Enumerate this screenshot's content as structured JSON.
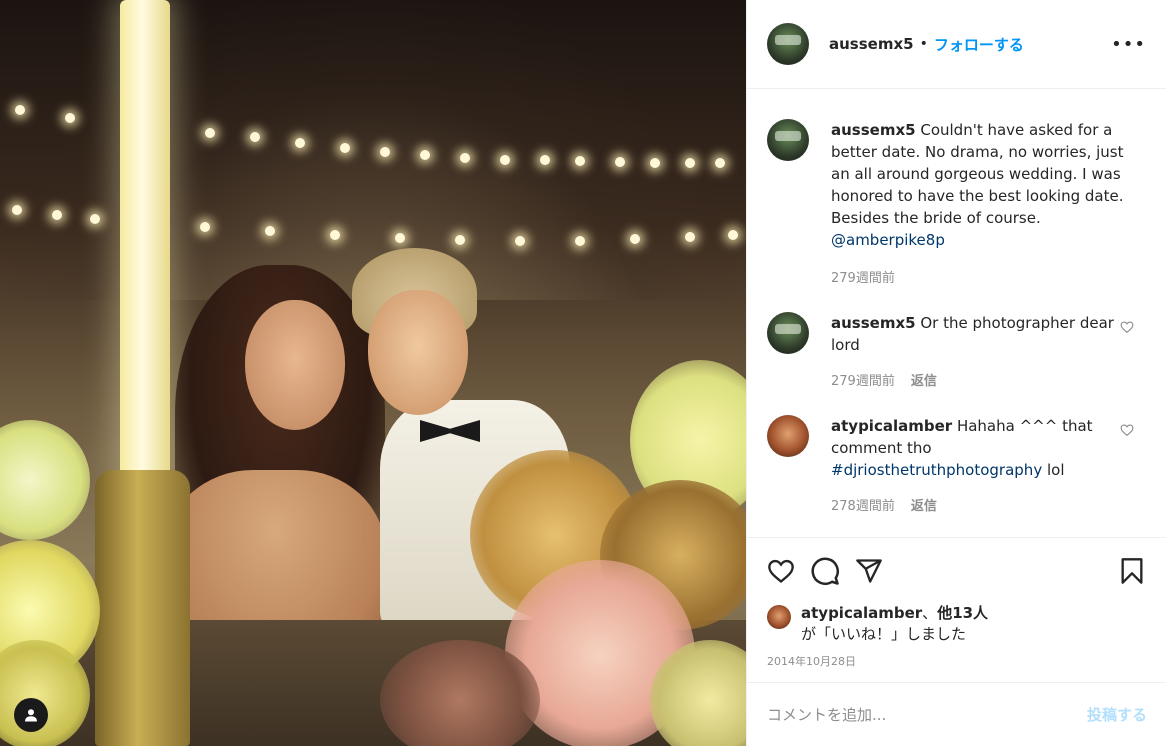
{
  "post": {
    "author": "aussemx5",
    "follow_label": "フォローする",
    "separator": "•",
    "more_label": "•••"
  },
  "comments": [
    {
      "user": "aussemx5",
      "text": "Couldn't have asked for a better date. No drama, no worries, just an all around gorgeous wedding. I was honored to have the best looking date. Besides the bride of course.",
      "mention": "@amberpike8p",
      "time": "279週間前"
    },
    {
      "user": "aussemx5",
      "text": "Or the photographer dear lord",
      "time": "279週間前",
      "reply": "返信"
    },
    {
      "user": "atypicalamber",
      "text": "Hahaha ^^^ that comment tho",
      "hashtag": "#djriosthetruthphotography",
      "suffix": "lol",
      "time": "278週間前",
      "reply": "返信"
    }
  ],
  "likes": {
    "user": "atypicalamber",
    "separator": "、",
    "others": "他13人",
    "line2": "が「いいね！」しました"
  },
  "date": "2014年10月28日",
  "add_comment": {
    "placeholder": "コメントを追加...",
    "post_label": "投稿する"
  },
  "colors": {
    "accent": "#0095f6",
    "link": "#00376b",
    "muted": "#8e8e8e",
    "post_disabled": "#b2dffc"
  }
}
